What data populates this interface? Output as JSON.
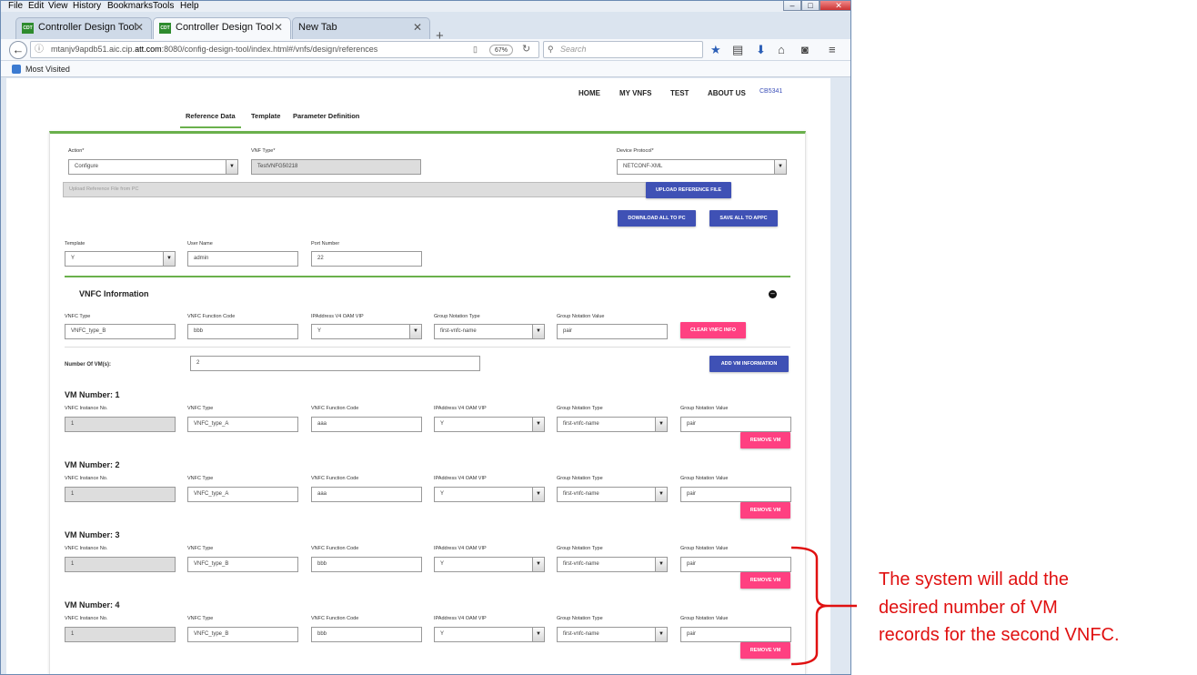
{
  "browser": {
    "menu": [
      "File",
      "Edit",
      "View",
      "History",
      "Bookmarks",
      "Tools",
      "Help"
    ],
    "tabs": [
      {
        "label": "Controller Design Tool",
        "favicon": "CDT"
      },
      {
        "label": "Controller Design Tool",
        "favicon": "CDT"
      },
      {
        "label": "New Tab"
      }
    ],
    "url": {
      "prefix": "mtanjv9apdb51.aic.cip.",
      "domain": "att.com",
      "suffix": ":8080/config-design-tool/index.html#/vnfs/design/references"
    },
    "zoom": "67%",
    "search_placeholder": "Search",
    "bookmark": "Most Visited"
  },
  "app": {
    "nav": [
      "HOME",
      "MY VNFS",
      "TEST",
      "ABOUT US"
    ],
    "user": "CB5341",
    "subtabs": [
      "Reference Data",
      "Template",
      "Parameter Definition"
    ],
    "active_subtab": 0
  },
  "form": {
    "action": {
      "label": "Action*",
      "value": "Configure"
    },
    "vnf_type": {
      "label": "VNF Type*",
      "value": "TestVNFG50218"
    },
    "device_protocol": {
      "label": "Device Protocol*",
      "value": "NETCONF-XML"
    },
    "upload": {
      "placeholder": "Upload Reference File from PC",
      "button": "UPLOAD REFERENCE FILE"
    },
    "download_button": "DOWNLOAD ALL TO PC",
    "save_button": "SAVE ALL TO APPC",
    "template": {
      "label": "Template",
      "value": "Y"
    },
    "user_name": {
      "label": "User Name",
      "value": "admin"
    },
    "port_number": {
      "label": "Port Number",
      "value": "22"
    }
  },
  "vnfc": {
    "title": "VNFC Information",
    "labels": {
      "type": "VNFC Type",
      "function_code": "VNFC Function Code",
      "ip": "IPAddress V4 OAM VIP",
      "gn_type": "Group Notation Type",
      "gn_value": "Group Notation Value"
    },
    "type": "VNFC_type_B",
    "function_code": "bbb",
    "ip": "Y",
    "gn_type": "first-vnfc-name",
    "gn_value": "pair",
    "clear_button": "CLEAR VNFC INFO",
    "num_vm_label": "Number Of VM(s):",
    "num_vm": "2",
    "add_vm_button": "ADD VM INFORMATION"
  },
  "vm_labels": {
    "instance": "VNFC Instance No.",
    "type": "VNFC Type",
    "function_code": "VNFC Function Code",
    "ip": "IPAddress V4 OAM VIP",
    "gn_type": "Group Notation Type",
    "gn_value": "Group Notation Value",
    "remove": "REMOVE VM"
  },
  "vms": [
    {
      "title": "VM Number: 1",
      "instance": "1",
      "type": "VNFC_type_A",
      "function_code": "aaa",
      "ip": "Y",
      "gn_type": "first-vnfc-name",
      "gn_value": "pair"
    },
    {
      "title": "VM Number: 2",
      "instance": "1",
      "type": "VNFC_type_A",
      "function_code": "aaa",
      "ip": "Y",
      "gn_type": "first-vnfc-name",
      "gn_value": "pair"
    },
    {
      "title": "VM Number: 3",
      "instance": "1",
      "type": "VNFC_type_B",
      "function_code": "bbb",
      "ip": "Y",
      "gn_type": "first-vnfc-name",
      "gn_value": "pair"
    },
    {
      "title": "VM Number: 4",
      "instance": "1",
      "type": "VNFC_type_B",
      "function_code": "bbb",
      "ip": "Y",
      "gn_type": "first-vnfc-name",
      "gn_value": "pair"
    }
  ],
  "annotation": {
    "lines": [
      "The system will add the",
      "desired number of VM",
      "records for the second VNFC."
    ],
    "color": "#e01010"
  },
  "colors": {
    "primary": "#3f51b5",
    "accent": "#ff4081",
    "green": "#6ab04c"
  }
}
